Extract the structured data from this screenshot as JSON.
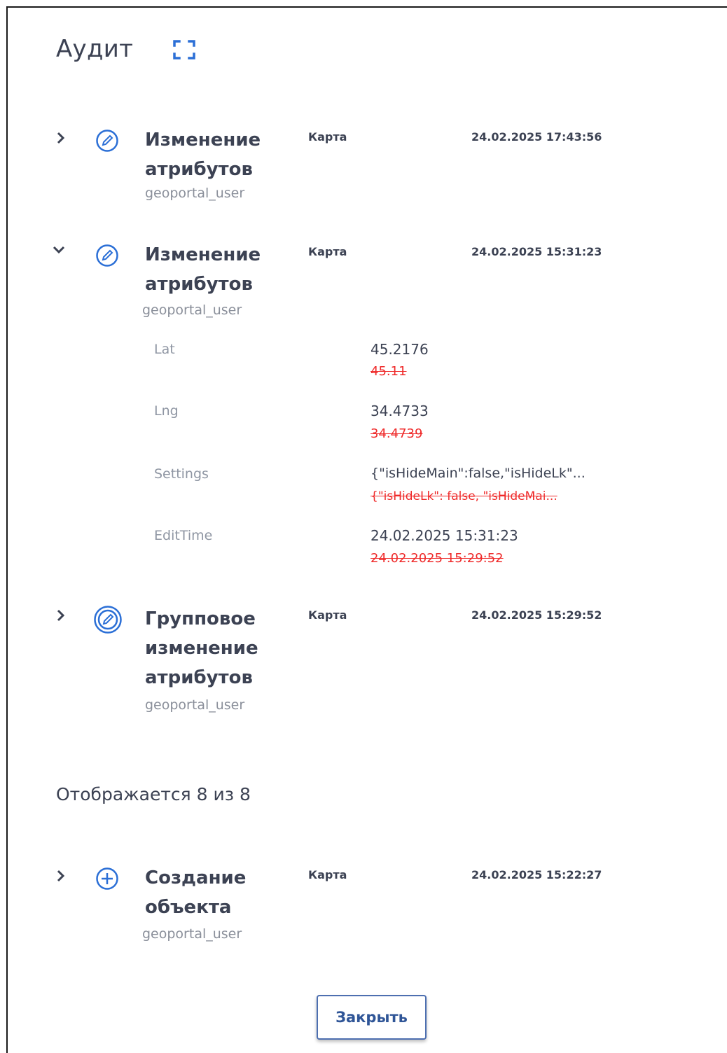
{
  "header": {
    "title": "Аудит",
    "fullscreen_icon": "fullscreen-icon"
  },
  "entries": [
    {
      "title_lines": [
        "Изменение",
        "атрибутов"
      ],
      "user": "geoportal_user",
      "source": "Карта",
      "date": "24.02.2025 17:43:56",
      "expanded": false,
      "icon": "edit-circle-icon"
    },
    {
      "title_lines": [
        "Изменение",
        "атрибутов"
      ],
      "user": "geoportal_user",
      "source": "Карта",
      "date": "24.02.2025 15:31:23",
      "expanded": true,
      "icon": "edit-circle-icon",
      "changes": [
        {
          "name": "Lat",
          "new": "45.2176",
          "old": "45.11"
        },
        {
          "name": "Lng",
          "new": "34.4733",
          "old": "34.4739"
        },
        {
          "name": "Settings",
          "new": "{\"isHideMain\":false,\"isHideLk\"...",
          "old": "{\"isHideLk\": false, \"isHideMai..."
        },
        {
          "name": "EditTime",
          "new": "24.02.2025 15:31:23",
          "old": "24.02.2025 15:29:52"
        }
      ]
    },
    {
      "title_lines": [
        "Групповое",
        "изменение",
        "атрибутов"
      ],
      "user": "geoportal_user",
      "source": "Карта",
      "date": "24.02.2025 15:29:52",
      "expanded": false,
      "icon": "group-edit-circle-icon"
    },
    {
      "title_lines": [
        "Создание",
        "объекта"
      ],
      "user": "geoportal_user",
      "source": "Карта",
      "date": "24.02.2025 15:22:27",
      "expanded": false,
      "icon": "plus-circle-icon"
    }
  ],
  "pagination": {
    "shown_text": "Отображается 8 из 8"
  },
  "footer": {
    "close_label": "Закрыть"
  },
  "colors": {
    "accent": "#2b6fd6",
    "text": "#3c4253",
    "muted": "#8a8f9a",
    "removed": "#ef2b2b",
    "button_border": "#4d6fb0"
  }
}
